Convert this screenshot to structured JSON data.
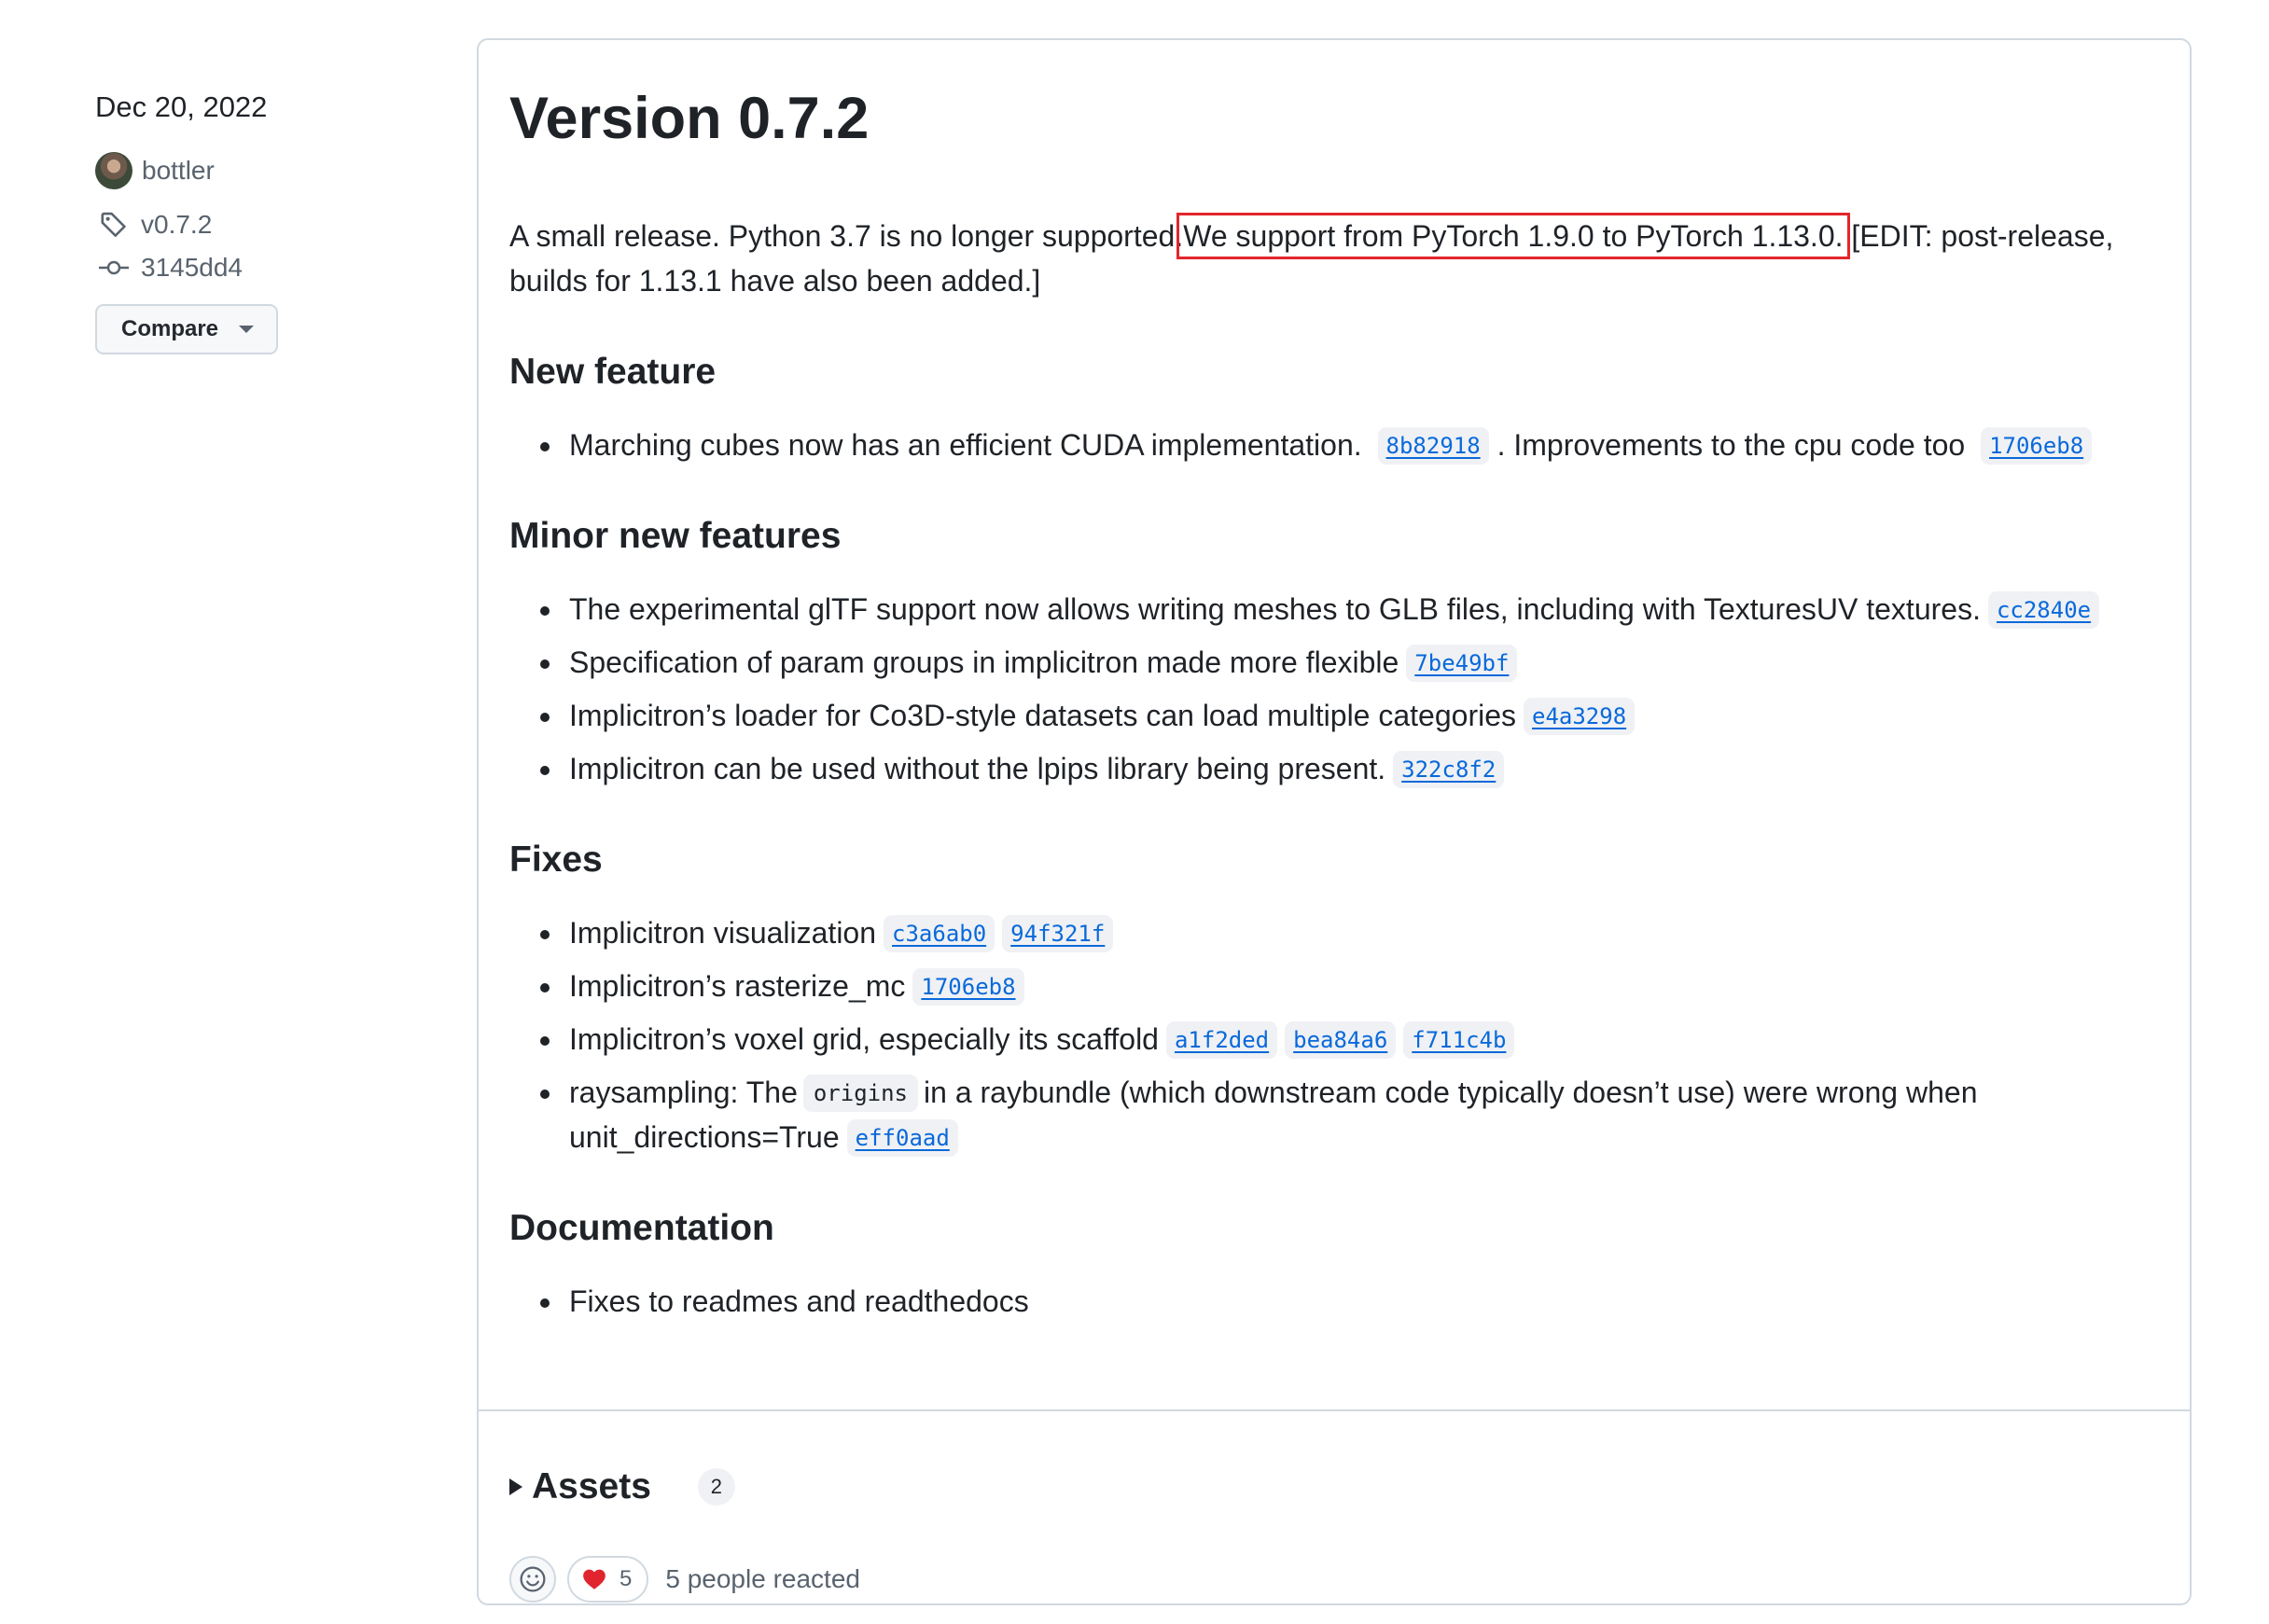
{
  "release": {
    "date": "Dec 20, 2022",
    "author": "bottler",
    "tag": "v0.7.2",
    "commit": "3145dd4",
    "compare_label": "Compare",
    "title": "Version 0.7.2"
  },
  "intro": {
    "part1": "A small release. Python 3.7 is no longer supported.",
    "highlighted": "We support from PyTorch 1.9.0 to PyTorch 1.13.0.",
    "part2": "[EDIT: post-release, builds for 1.13.1 have also been added.]"
  },
  "sections": {
    "new_feature": {
      "heading": "New feature",
      "item1": {
        "text_a": "Marching cubes now has an efficient CUDA implementation.",
        "sha_a": "8b82918",
        "text_b": ". Improvements to the cpu code too",
        "sha_b": "1706eb8"
      }
    },
    "minor": {
      "heading": "Minor new features",
      "item1": {
        "text": "The experimental glTF support now allows writing meshes to GLB files, including with TexturesUV textures.",
        "sha": "cc2840e"
      },
      "item2": {
        "text": "Specification of param groups in implicitron made more flexible",
        "sha": "7be49bf"
      },
      "item3": {
        "text": "Implicitron’s loader for Co3D-style datasets can load multiple categories",
        "sha": "e4a3298"
      },
      "item4": {
        "text": "Implicitron can be used without the lpips library being present.",
        "sha": "322c8f2"
      }
    },
    "fixes": {
      "heading": "Fixes",
      "item1": {
        "text": "Implicitron visualization",
        "sha_a": "c3a6ab0",
        "sha_b": "94f321f"
      },
      "item2": {
        "text": "Implicitron’s rasterize_mc",
        "sha": "1706eb8"
      },
      "item3": {
        "text": "Implicitron’s voxel grid, especially its scaffold",
        "sha_a": "a1f2ded",
        "sha_b": "bea84a6",
        "sha_c": "f711c4b"
      },
      "item4": {
        "text_a": "raysampling: The",
        "code": "origins",
        "text_b": "in a raybundle (which downstream code typically doesn’t use) were wrong when unit_directions=True",
        "sha": "eff0aad"
      }
    },
    "docs": {
      "heading": "Documentation",
      "item1": {
        "text": "Fixes to readmes and readthedocs"
      }
    }
  },
  "assets": {
    "label": "Assets",
    "count": "2"
  },
  "reactions": {
    "heart_count": "5",
    "summary": "5 people reacted"
  },
  "colors": {
    "link": "#0969da",
    "highlight_box": "#e3262b",
    "heart": "#e0252f"
  }
}
